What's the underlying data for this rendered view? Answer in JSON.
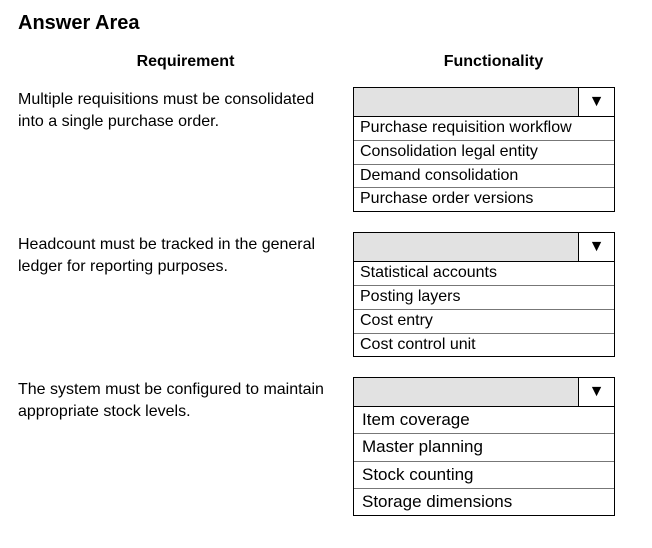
{
  "title": "Answer Area",
  "headers": {
    "left": "Requirement",
    "right": "Functionality"
  },
  "rows": [
    {
      "requirement": "Multiple requisitions must be consolidated into a single purchase order.",
      "options": [
        "Purchase requisition workflow",
        "Consolidation legal entity",
        "Demand consolidation",
        "Purchase order versions"
      ]
    },
    {
      "requirement": "Headcount must be tracked in the general ledger for reporting purposes.",
      "options": [
        "Statistical accounts",
        "Posting layers",
        "Cost entry",
        "Cost control unit"
      ]
    },
    {
      "requirement": "The system must be configured to maintain appropriate stock levels.",
      "options": [
        "Item coverage",
        "Master planning",
        "Stock counting",
        "Storage dimensions"
      ]
    }
  ]
}
